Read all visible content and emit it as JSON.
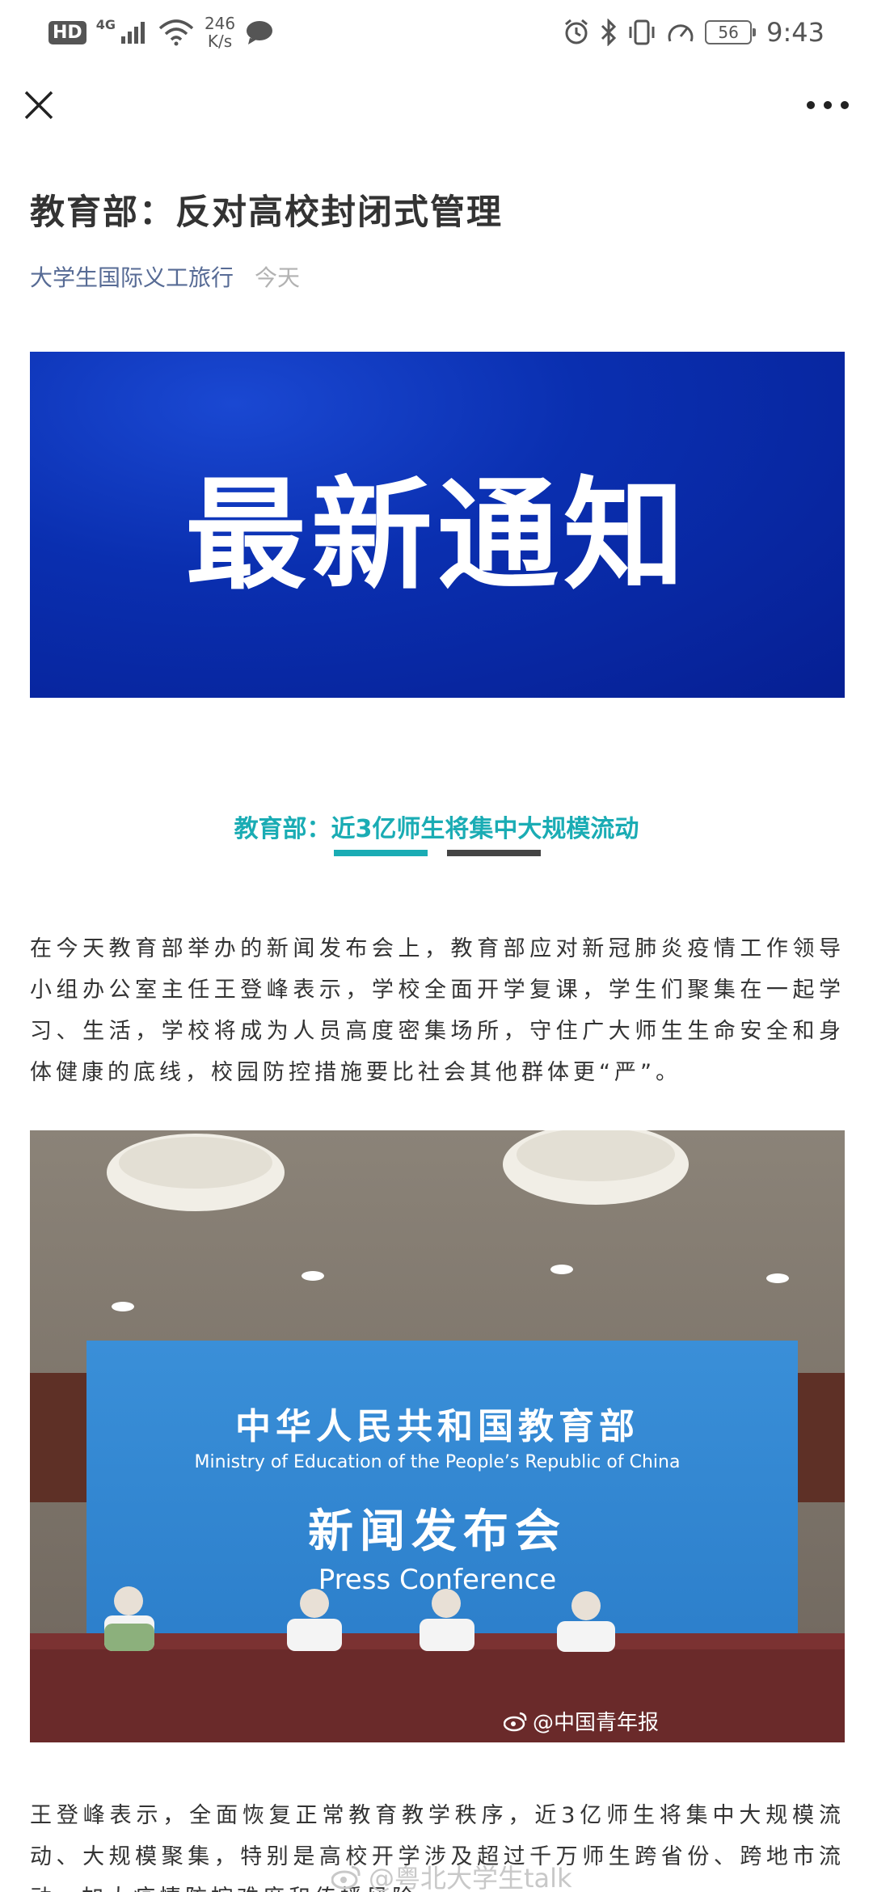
{
  "status_bar": {
    "hd": "HD",
    "network": "4G",
    "speed_value": "246",
    "speed_unit": "K/s",
    "battery": "56",
    "time": "9:43"
  },
  "article": {
    "title": "教育部：反对高校封闭式管理",
    "account": "大学生国际义工旅行",
    "date": "今天"
  },
  "banner": {
    "text": "最新通知"
  },
  "section": {
    "heading": "教育部：近3亿师生将集中大规模流动"
  },
  "paragraphs": [
    "在今天教育部举办的新闻发布会上，教育部应对新冠肺炎疫情工作领导小组办公室主任王登峰表示，学校全面开学复课，学生们聚集在一起学习、生活，学校将成为人员高度密集场所，守住广大师生生命安全和身体健康的底线，校园防控措施要比社会其他群体更“严”。",
    "王登峰表示，全面恢复正常教育教学秩序，近3亿师生将集中大规模流动、大规模聚集，特别是高校开学涉及超过千万师生跨省份、跨地市流动，加大疫情防控难度和传播风险。"
  ],
  "photo": {
    "backdrop_title": "中华人民共和国教育部",
    "backdrop_subtitle": "Ministry of Education of the People’s Republic of China",
    "backdrop_event": "新闻发布会",
    "backdrop_event_en": "Press Conference",
    "watermark": "@中国青年报"
  },
  "bottom_watermark": "@粤北大学生talk"
}
